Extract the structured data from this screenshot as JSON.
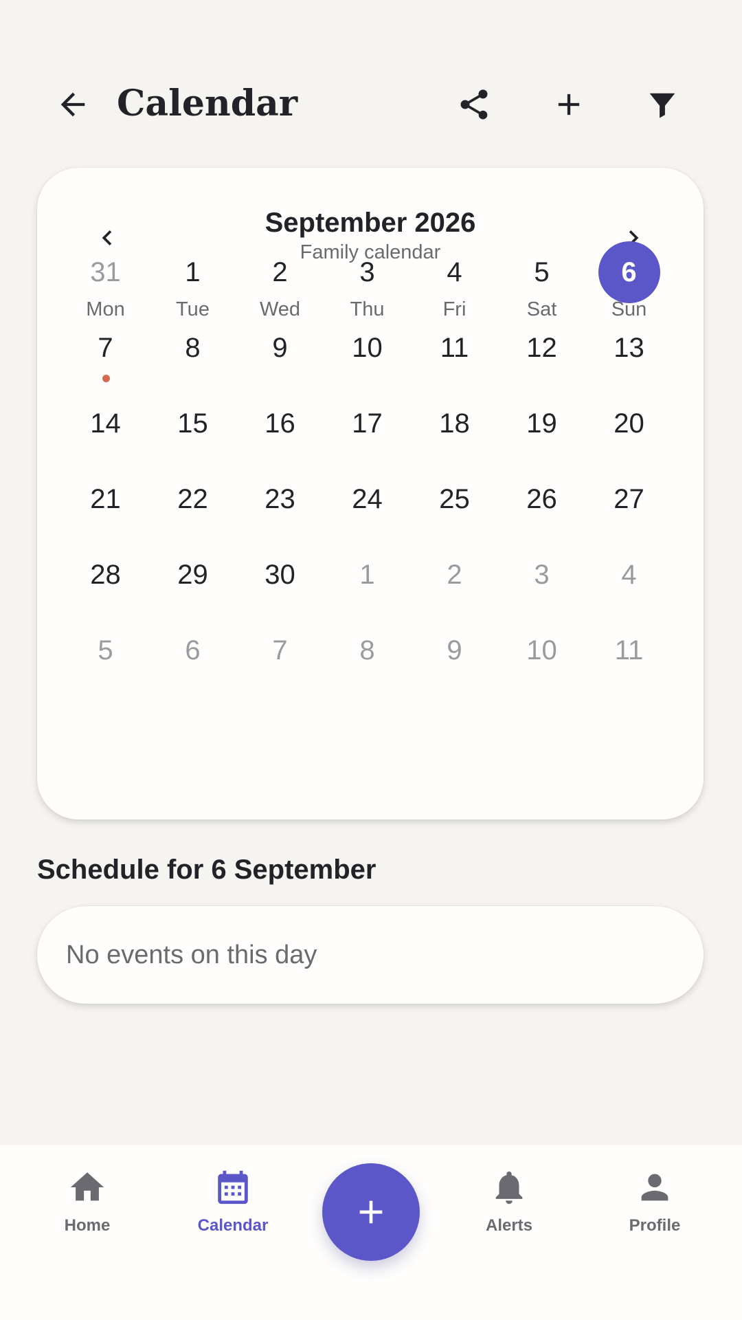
{
  "header": {
    "title": "Calendar",
    "icons": {
      "back": "arrow-left-icon",
      "share": "share-icon",
      "add": "plus-icon",
      "filter": "filter-icon"
    }
  },
  "calendar": {
    "month_label": "September 2026",
    "subtitle": "Family calendar",
    "weekdays": [
      "Mon",
      "Tue",
      "Wed",
      "Thu",
      "Fri",
      "Sat",
      "Sun"
    ],
    "weeks": [
      [
        {
          "d": "31",
          "muted": true
        },
        {
          "d": "1"
        },
        {
          "d": "2"
        },
        {
          "d": "3"
        },
        {
          "d": "4"
        },
        {
          "d": "5"
        },
        {
          "d": "6",
          "selected": true
        }
      ],
      [
        {
          "d": "7",
          "event": true
        },
        {
          "d": "8"
        },
        {
          "d": "9"
        },
        {
          "d": "10"
        },
        {
          "d": "11"
        },
        {
          "d": "12"
        },
        {
          "d": "13"
        }
      ],
      [
        {
          "d": "14"
        },
        {
          "d": "15"
        },
        {
          "d": "16"
        },
        {
          "d": "17"
        },
        {
          "d": "18"
        },
        {
          "d": "19"
        },
        {
          "d": "20"
        }
      ],
      [
        {
          "d": "21"
        },
        {
          "d": "22"
        },
        {
          "d": "23"
        },
        {
          "d": "24"
        },
        {
          "d": "25"
        },
        {
          "d": "26"
        },
        {
          "d": "27"
        }
      ],
      [
        {
          "d": "28"
        },
        {
          "d": "29"
        },
        {
          "d": "30"
        },
        {
          "d": "1",
          "muted": true
        },
        {
          "d": "2",
          "muted": true
        },
        {
          "d": "3",
          "muted": true
        },
        {
          "d": "4",
          "muted": true
        }
      ],
      [
        {
          "d": "5",
          "muted": true
        },
        {
          "d": "6",
          "muted": true
        },
        {
          "d": "7",
          "muted": true
        },
        {
          "d": "8",
          "muted": true
        },
        {
          "d": "9",
          "muted": true
        },
        {
          "d": "10",
          "muted": true
        },
        {
          "d": "11",
          "muted": true
        }
      ]
    ],
    "colors": {
      "accent": "#5b57c8",
      "event_dot": "#d46a4f"
    }
  },
  "schedule": {
    "title": "Schedule for 6 September",
    "empty_text": "No events on this day"
  },
  "bottom_nav": {
    "items": [
      {
        "label": "Home",
        "icon": "home-icon",
        "active": false
      },
      {
        "label": "Calendar",
        "icon": "calendar-icon",
        "active": true
      },
      {
        "label": "Alerts",
        "icon": "bell-icon",
        "active": false
      },
      {
        "label": "Profile",
        "icon": "person-icon",
        "active": false
      }
    ],
    "fab_icon": "plus-icon"
  }
}
